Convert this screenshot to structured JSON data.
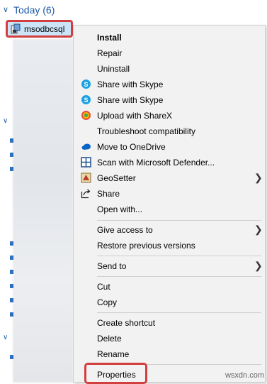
{
  "group": {
    "title": "Today (6)"
  },
  "file": {
    "name": "msodbcsql",
    "icon": "installer-icon"
  },
  "menu": {
    "items": [
      {
        "label": "Install",
        "bold": true,
        "icon": ""
      },
      {
        "label": "Repair",
        "icon": ""
      },
      {
        "label": "Uninstall",
        "icon": ""
      },
      {
        "label": "Share with Skype",
        "icon": "skype-icon"
      },
      {
        "label": "Share with Skype",
        "icon": "skype-icon"
      },
      {
        "label": "Upload with ShareX",
        "icon": "sharex-icon"
      },
      {
        "label": "Troubleshoot compatibility",
        "icon": ""
      },
      {
        "label": "Move to OneDrive",
        "icon": "onedrive-icon"
      },
      {
        "label": "Scan with Microsoft Defender...",
        "icon": "defender-icon"
      },
      {
        "label": "GeoSetter",
        "icon": "geosetter-icon",
        "submenu": true
      },
      {
        "label": "Share",
        "icon": "share-icon"
      },
      {
        "label": "Open with...",
        "icon": ""
      },
      {
        "label": "Give access to",
        "icon": "",
        "submenu": true
      },
      {
        "label": "Restore previous versions",
        "icon": ""
      },
      {
        "label": "Send to",
        "icon": "",
        "submenu": true
      },
      {
        "label": "Cut",
        "icon": ""
      },
      {
        "label": "Copy",
        "icon": ""
      },
      {
        "label": "Create shortcut",
        "icon": ""
      },
      {
        "label": "Delete",
        "icon": ""
      },
      {
        "label": "Rename",
        "icon": ""
      },
      {
        "label": "Properties",
        "icon": "",
        "highlighted": true
      }
    ],
    "submenu_glyph": "❯"
  },
  "watermark": "wsxdn.com",
  "colors": {
    "accent": "#1e5aa8",
    "highlight_border": "#d23f3f",
    "menu_bg": "#f2f2f2"
  }
}
